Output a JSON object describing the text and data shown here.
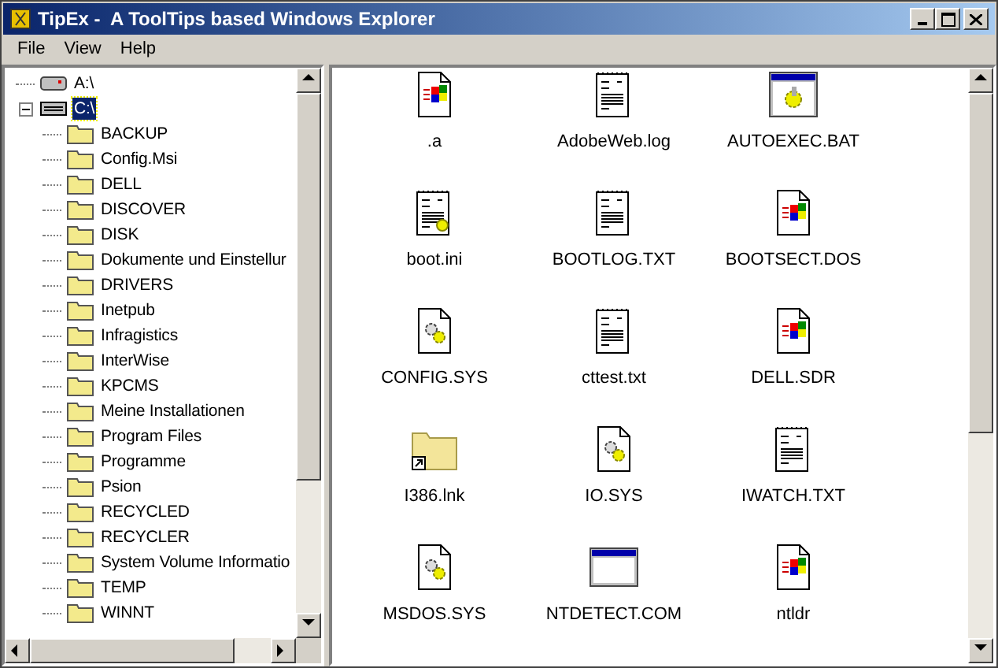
{
  "window": {
    "title": "TipEx -  A ToolTips based Windows Explorer"
  },
  "menu": [
    "File",
    "View",
    "Help"
  ],
  "tree": [
    {
      "label": "A:\\",
      "kind": "floppy",
      "selected": false
    },
    {
      "label": "C:\\",
      "kind": "disk",
      "selected": true,
      "expanded": true,
      "children": [
        {
          "label": "BACKUP",
          "kind": "folder",
          "selected": false
        },
        {
          "label": "Config.Msi",
          "kind": "folder",
          "selected": false
        },
        {
          "label": "DELL",
          "kind": "folder",
          "selected": false
        },
        {
          "label": "DISCOVER",
          "kind": "folder",
          "selected": false
        },
        {
          "label": "DISK",
          "kind": "folder",
          "selected": false
        },
        {
          "label": "Dokumente und Einstellur",
          "kind": "folder",
          "selected": false
        },
        {
          "label": "DRIVERS",
          "kind": "folder",
          "selected": false
        },
        {
          "label": "Inetpub",
          "kind": "folder",
          "selected": false
        },
        {
          "label": "Infragistics",
          "kind": "folder",
          "selected": false
        },
        {
          "label": "InterWise",
          "kind": "folder",
          "selected": false
        },
        {
          "label": "KPCMS",
          "kind": "folder",
          "selected": false
        },
        {
          "label": "Meine Installationen",
          "kind": "folder",
          "selected": false
        },
        {
          "label": "Program Files",
          "kind": "folder",
          "selected": false
        },
        {
          "label": "Programme",
          "kind": "folder",
          "selected": false
        },
        {
          "label": "Psion",
          "kind": "folder",
          "selected": false
        },
        {
          "label": "RECYCLED",
          "kind": "folder",
          "selected": false
        },
        {
          "label": "RECYCLER",
          "kind": "folder",
          "selected": false
        },
        {
          "label": "System Volume Informatio",
          "kind": "folder",
          "selected": false
        },
        {
          "label": "TEMP",
          "kind": "folder",
          "selected": false
        },
        {
          "label": "WINNT",
          "kind": "folder",
          "selected": false
        }
      ]
    }
  ],
  "files": [
    {
      "name": ".a",
      "kind": "system"
    },
    {
      "name": "AdobeWeb.log",
      "kind": "text"
    },
    {
      "name": "AUTOEXEC.BAT",
      "kind": "batch"
    },
    {
      "name": "boot.ini",
      "kind": "settings"
    },
    {
      "name": "BOOTLOG.TXT",
      "kind": "text"
    },
    {
      "name": "BOOTSECT.DOS",
      "kind": "system"
    },
    {
      "name": "CONFIG.SYS",
      "kind": "gears"
    },
    {
      "name": "cttest.txt",
      "kind": "text"
    },
    {
      "name": "DELL.SDR",
      "kind": "system"
    },
    {
      "name": "I386.lnk",
      "kind": "shortcut"
    },
    {
      "name": "IO.SYS",
      "kind": "gears"
    },
    {
      "name": "IWATCH.TXT",
      "kind": "text"
    },
    {
      "name": "MSDOS.SYS",
      "kind": "gears"
    },
    {
      "name": "NTDETECT.COM",
      "kind": "program"
    },
    {
      "name": "ntldr",
      "kind": "system"
    }
  ]
}
